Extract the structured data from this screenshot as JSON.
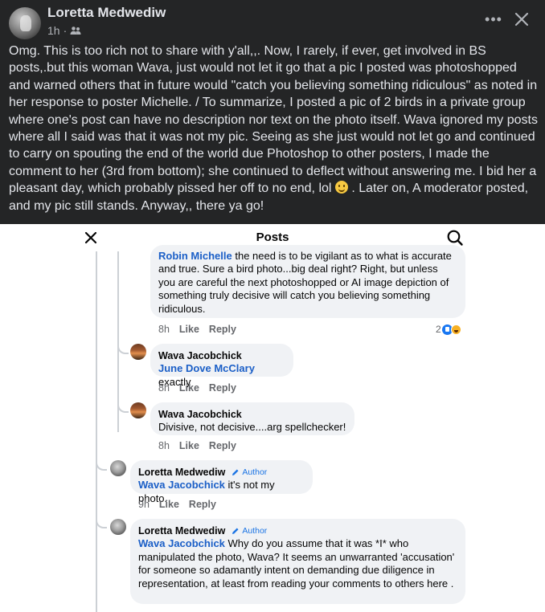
{
  "post": {
    "author": "Loretta Medwediw",
    "time": "1h",
    "separator": "·",
    "audience_icon": "group-icon",
    "more_icon": "more-options-icon",
    "more_label": "•••",
    "close_icon": "close-icon",
    "body_part1": "Omg.  This is too rich not to share with y'all,,.  Now, I rarely, if ever, get involved in BS posts,.but this woman Wava, just would not let it go that a pic I posted was photoshopped and warned others that in future would \"catch you believing something ridiculous\" as noted in her response to poster Michelle.  / To summarize, I posted a pic of 2 birds in a private group where one's post can have no description nor text on the photo itself.  Wava ignored my posts where all I said was that it was not my pic.  Seeing as she just would not let go and continued to carry on spouting the end of the world due Photoshop to other posters, I made the comment to her (3rd from bottom); she continued to deflect without answering me.  I bid her a pleasant day, which probably pissed her off to no end, lol",
    "body_emoji": "slightly-smiling-face-emoji",
    "body_part2": " . Later on, A moderator posted, and my pic still stands.  Anyway,, there ya go!"
  },
  "screenshot": {
    "title": "Posts",
    "back_icon": "close-x-icon",
    "search_icon": "search-icon",
    "comments": [
      {
        "mention": "Robin Michelle",
        "text": " the need is to be vigilant as to what is accurate and true. Sure a bird photo...big deal right? Right, but unless you are careful the next photoshopped or AI image depiction of something truly decisive will catch you believing something ridiculous.",
        "time": "8h",
        "like": "Like",
        "reply": "Reply",
        "reaction_count": "2"
      },
      {
        "author": "Wava Jacobchick",
        "mention": "June Dove McClary",
        "text": " exactly",
        "time": "8h",
        "like": "Like",
        "reply": "Reply"
      },
      {
        "author": "Wava Jacobchick",
        "text": "Divisive, not decisive....arg spellchecker!",
        "time": "8h",
        "like": "Like",
        "reply": "Reply"
      },
      {
        "author": "Loretta Medwediw",
        "badge": "Author",
        "mention": "Wava Jacobchick",
        "text": " it's not my photo.",
        "time": "9h",
        "like": "Like",
        "reply": "Reply"
      },
      {
        "author": "Loretta Medwediw",
        "badge": "Author",
        "mention": "Wava Jacobchick",
        "text": " Why do you assume that it was *I* who manipulated the photo, Wava?  It seems an unwarranted 'accusation' for someone so adamantly intent on demanding due diligence in representation, at least from reading your comments to others here ."
      }
    ]
  },
  "colors": {
    "background": "#242526",
    "text": "#e4e6eb",
    "meta": "#b0b3b8",
    "link": "#1b5fc7",
    "bubble": "#f0f2f5"
  }
}
